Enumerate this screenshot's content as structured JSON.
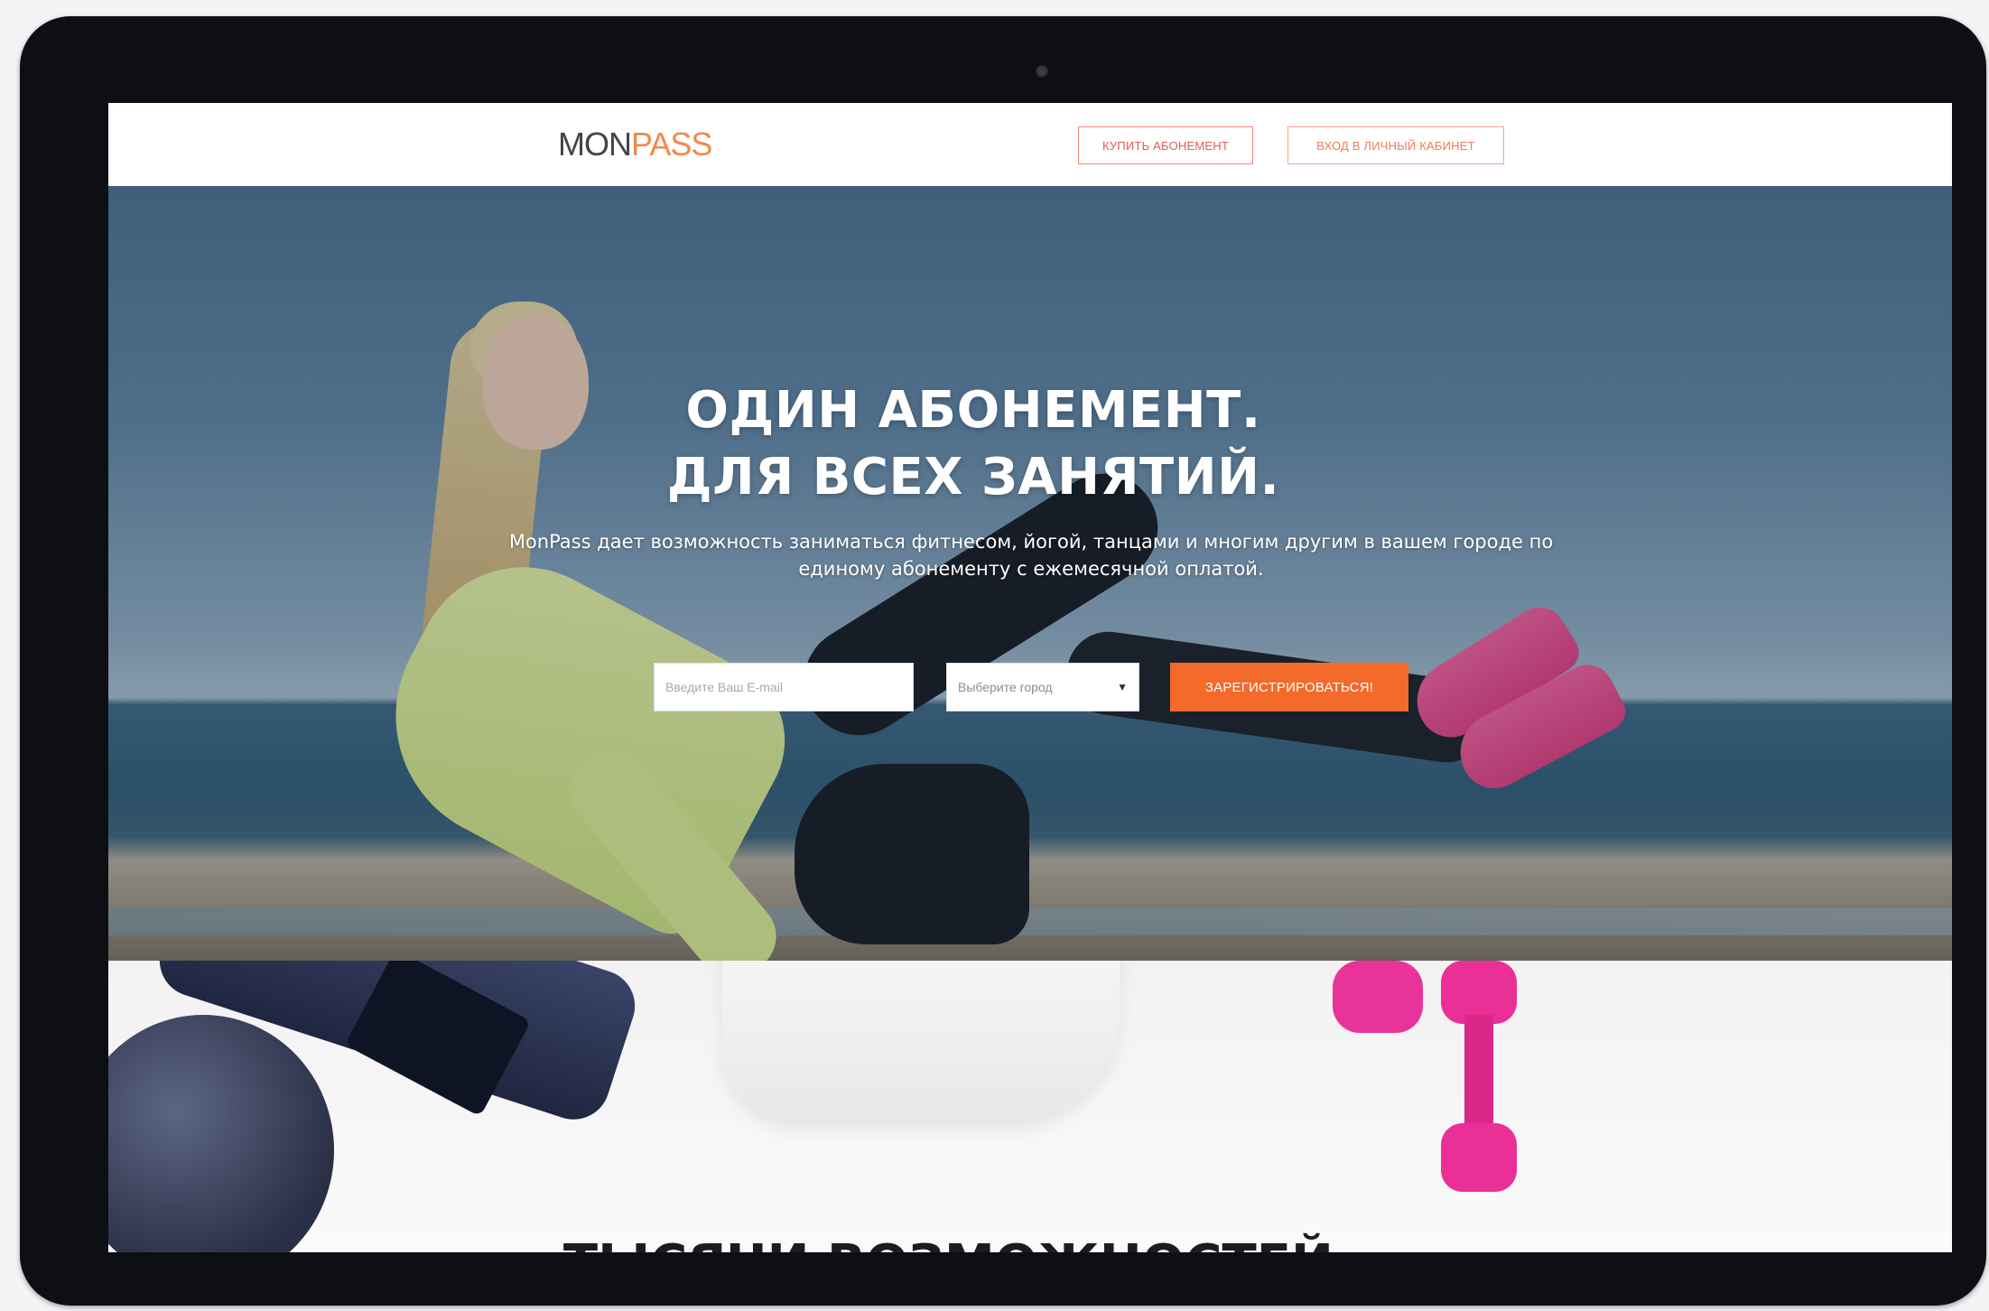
{
  "header": {
    "logo_mon": "MON",
    "logo_pass": "PASS",
    "nav": {
      "buy_label": "купить абонемент",
      "login_label": "вход в личный кабинет"
    }
  },
  "hero": {
    "title_line1": "ОДИН АБОНЕМЕНТ.",
    "title_line2": "ДЛЯ ВСЕХ ЗАНЯТИЙ.",
    "subtitle": "MonPass дает возможность заниматься фитнесом, йогой, танцами и многим другим в вашем городе по единому абонементу с ежемесячной оплатой.",
    "form": {
      "name_placeholder": "Введите Ваш E-mail",
      "city_selected": "Выберите город",
      "submit_label": "зарегистрироваться!"
    }
  },
  "section_two": {
    "title": "ТЫСЯЧИ ВОЗМОЖНОСТЕЙ."
  },
  "colors": {
    "accent_orange": "#f36a2b",
    "nav_border": "#ef8a7a",
    "device_frame": "#0d0f15"
  }
}
